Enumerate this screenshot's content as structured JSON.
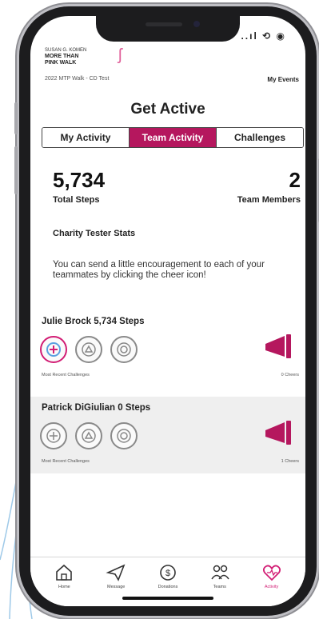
{
  "status": {
    "icons": "..ıl ⟲ ◉"
  },
  "header": {
    "brand_subtitle": "SUSAN G. KOMEN",
    "brand_line1": "MORE THAN",
    "brand_line2": "PINK WALK",
    "event_name": "2022 MTP Walk - CD Test",
    "my_events": "My Events"
  },
  "page": {
    "title": "Get Active"
  },
  "tabs": [
    {
      "label": "My Activity",
      "active": false
    },
    {
      "label": "Team Activity",
      "active": true
    },
    {
      "label": "Challenges",
      "active": false
    }
  ],
  "stats": {
    "total_steps_value": "5,734",
    "total_steps_label": "Total Steps",
    "team_members_value": "2",
    "team_members_label": "Team Members"
  },
  "team": {
    "name": "Charity Tester Stats",
    "info": "You can send a little encouragement to each of your teammates by clicking the cheer icon!"
  },
  "members": [
    {
      "name": "Julie Brock 5,734 Steps",
      "recent_label": "Most Recent Challenges",
      "cheers": "0 Cheers"
    },
    {
      "name": "Patrick DiGiulian 0 Steps",
      "recent_label": "Most Recent Challenges",
      "cheers": "1 Cheers"
    }
  ],
  "nav": [
    {
      "label": "Home",
      "icon": "home-icon"
    },
    {
      "label": "Message",
      "icon": "send-icon"
    },
    {
      "label": "Donations",
      "icon": "dollar-icon"
    },
    {
      "label": "Teams",
      "icon": "people-icon"
    },
    {
      "label": "Activity",
      "icon": "heart-icon",
      "active": true
    }
  ],
  "colors": {
    "accent": "#b5175e",
    "pink": "#d21c74"
  }
}
